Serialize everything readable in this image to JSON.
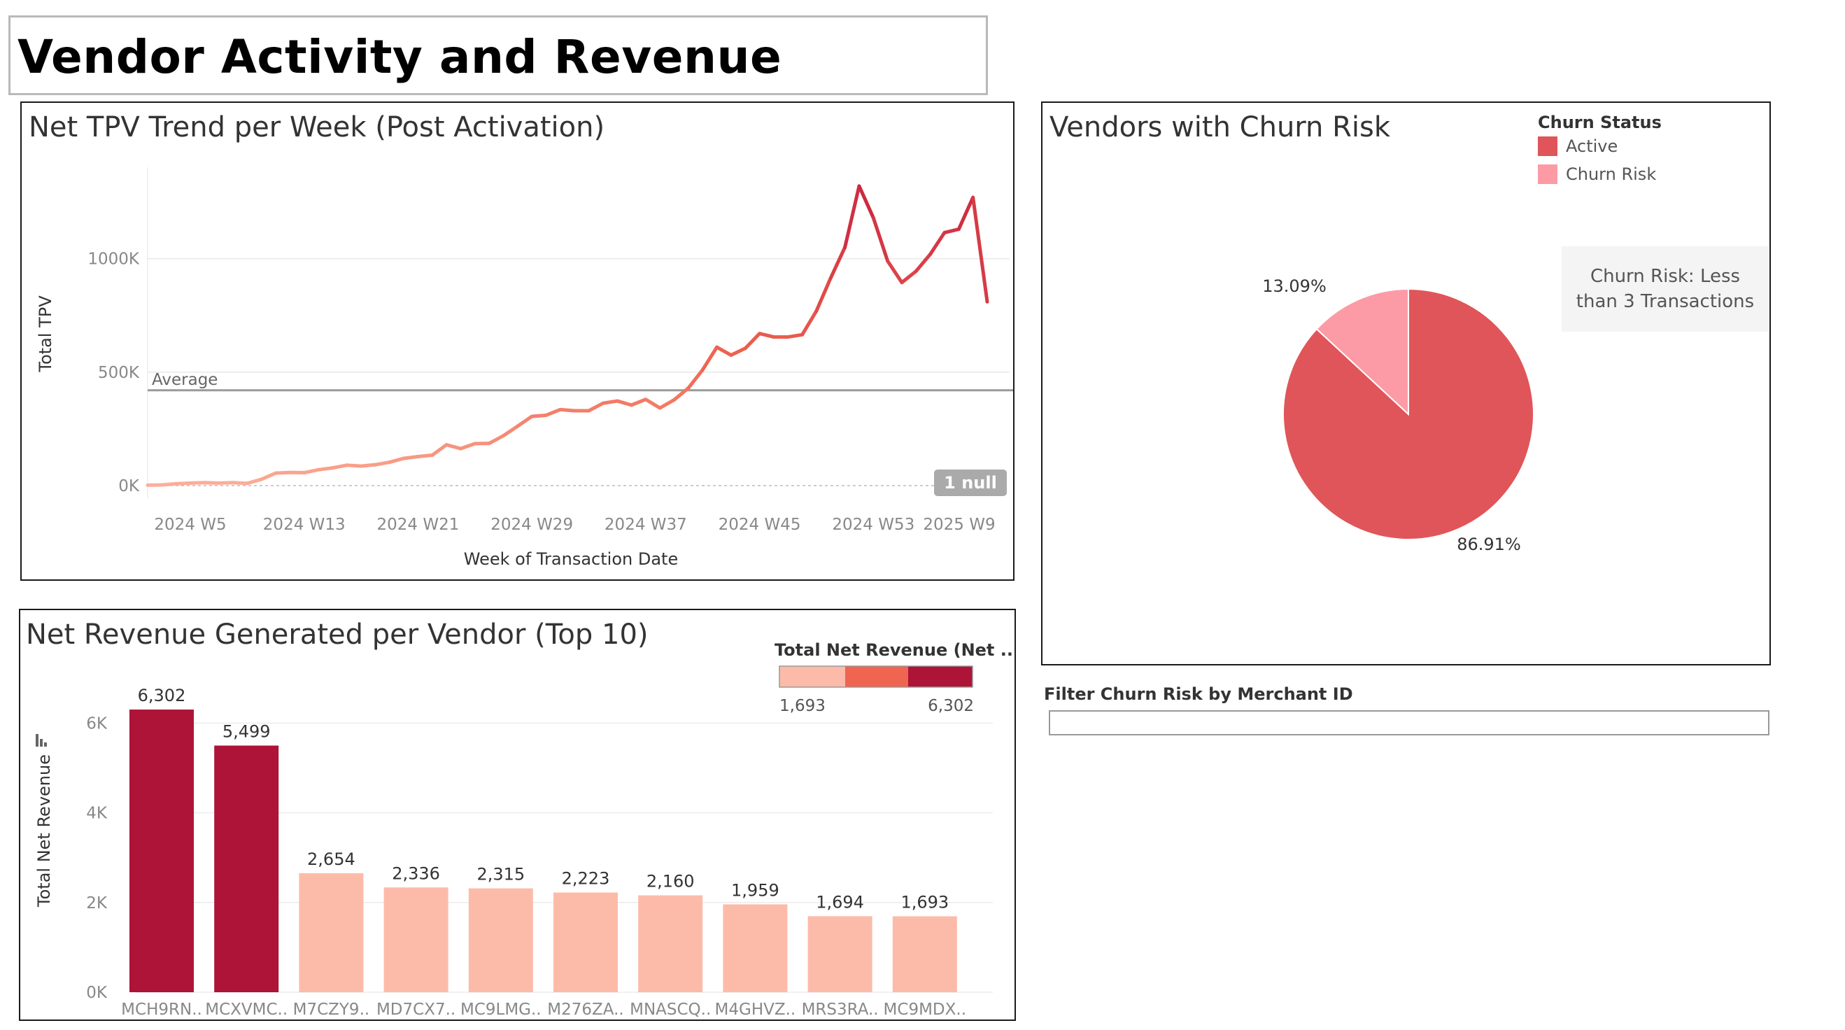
{
  "dashboard": {
    "title": "Vendor Activity and Revenue"
  },
  "colors": {
    "dark_red": "#ad1438",
    "light_salmon": "#fcbba9",
    "mid_salmon": "#ef6550",
    "pie_active": "#e05559",
    "pie_churn": "#fc9ba6",
    "line_light": "#fcb09b",
    "line_dark": "#c9243f"
  },
  "tpv": {
    "title": "Net TPV Trend per Week (Post Activation)",
    "ylabel": "Total TPV",
    "xlabel": "Week of Transaction Date",
    "average_label": "Average",
    "null_badge": "1 null"
  },
  "churn": {
    "title": "Vendors with Churn Risk",
    "legend_title": "Churn Status",
    "legend": [
      {
        "label": "Active",
        "color": "#e05559"
      },
      {
        "label": "Churn Risk",
        "color": "#fc9ba6"
      }
    ],
    "note": "Churn Risk: Less than 3 Transactions"
  },
  "revenue": {
    "title": "Net Revenue Generated per Vendor (Top 10)",
    "ylabel": "Total Net Revenue",
    "legend_title": "Total Net Revenue (Net ..",
    "legend_min": "1,693",
    "legend_max": "6,302"
  },
  "filter": {
    "label": "Filter Churn Risk by Merchant ID",
    "value": ""
  },
  "chart_data": [
    {
      "type": "line",
      "title": "Net TPV Trend per Week (Post Activation)",
      "xlabel": "Week of Transaction Date",
      "ylabel": "Total TPV",
      "x_ticks": [
        "2024 W5",
        "2024 W13",
        "2024 W21",
        "2024 W29",
        "2024 W37",
        "2024 W45",
        "2024 W53",
        "2025 W9"
      ],
      "y_ticks": [
        "0K",
        "500K",
        "1000K"
      ],
      "ylim": [
        0,
        1400000
      ],
      "average": 420000,
      "x_start_week": 2,
      "series": [
        {
          "values": [
            2000,
            3000,
            8000,
            11000,
            13000,
            11000,
            13000,
            10000,
            28000,
            55000,
            58000,
            57000,
            70000,
            78000,
            90000,
            86000,
            92000,
            103000,
            120000,
            128000,
            134000,
            180000,
            163000,
            185000,
            186000,
            220000,
            262000,
            305000,
            310000,
            335000,
            330000,
            330000,
            363000,
            373000,
            355000,
            380000,
            342000,
            378000,
            430000,
            510000,
            610000,
            575000,
            605000,
            670000,
            655000,
            655000,
            665000,
            770000,
            915000,
            1050000,
            1320000,
            1180000,
            990000,
            895000,
            945000,
            1020000,
            1115000,
            1130000,
            1270000,
            810000
          ]
        }
      ]
    },
    {
      "type": "pie",
      "title": "Vendors with Churn Risk",
      "categories": [
        "Active",
        "Churn Risk"
      ],
      "values": [
        86.91,
        13.09
      ],
      "value_labels": [
        "86.91%",
        "13.09%"
      ]
    },
    {
      "type": "bar",
      "title": "Net Revenue Generated per Vendor (Top 10)",
      "ylabel": "Total Net Revenue",
      "categories": [
        "MCH9RN..",
        "MCXVMC..",
        "M7CZY9..",
        "MD7CX7..",
        "MC9LMG..",
        "M276ZA..",
        "MNASCQ..",
        "M4GHVZ..",
        "MRS3RA..",
        "MC9MDX.."
      ],
      "values": [
        6302,
        5499,
        2654,
        2336,
        2315,
        2223,
        2160,
        1959,
        1694,
        1693
      ],
      "value_labels": [
        "6,302",
        "5,499",
        "2,654",
        "2,336",
        "2,315",
        "2,223",
        "2,160",
        "1,959",
        "1,694",
        "1,693"
      ],
      "y_ticks": [
        "0K",
        "2K",
        "4K",
        "6K"
      ],
      "ylim": [
        0,
        6800
      ]
    }
  ]
}
